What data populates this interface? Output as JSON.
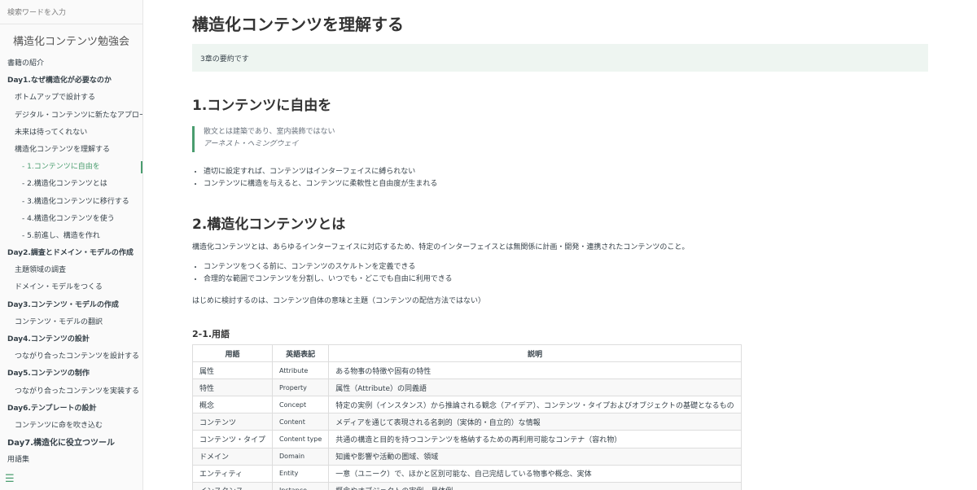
{
  "search": {
    "placeholder": "検索ワードを入力"
  },
  "sidebar": {
    "title": "構造化コンテンツ勉強会",
    "items": [
      {
        "label": "書籍の紹介"
      },
      {
        "label": "Day1.なぜ構造化が必要なのか"
      },
      {
        "label": "ボトムアップで設計する"
      },
      {
        "label": "デジタル・コンテンツに新たなアプロー..."
      },
      {
        "label": "未来は待ってくれない"
      },
      {
        "label": "構造化コンテンツを理解する"
      },
      {
        "label": "- 1.コンテンツに自由を"
      },
      {
        "label": "- 2.構造化コンテンツとは"
      },
      {
        "label": "- 3.構造化コンテンツに移行する"
      },
      {
        "label": "- 4.構造化コンテンツを使う"
      },
      {
        "label": "- 5.前進し、構造を作れ"
      },
      {
        "label": "Day2.調査とドメイン・モデルの作成"
      },
      {
        "label": "主題領域の調査"
      },
      {
        "label": "ドメイン・モデルをつくる"
      },
      {
        "label": "Day3.コンテンツ・モデルの作成"
      },
      {
        "label": "コンテンツ・モデルの翻訳"
      },
      {
        "label": "Day4.コンテンツの設計"
      },
      {
        "label": "つながり合ったコンテンツを設計する"
      },
      {
        "label": "Day5.コンテンツの制作"
      },
      {
        "label": "つながり合ったコンテンツを実装する"
      },
      {
        "label": "Day6.テンプレートの設計"
      },
      {
        "label": "コンテンツに命を吹き込む"
      },
      {
        "label": "Day7.構造化に役立つツール"
      },
      {
        "label": "用語集"
      }
    ],
    "menu_icon": "hamburger-icon",
    "accent_color": "#4a9d6f"
  },
  "main": {
    "title": "構造化コンテンツを理解する",
    "summary": "3章の要約です",
    "section1": {
      "heading": "1.コンテンツに自由を",
      "quote": "散文とは建築であり、室内装飾ではない",
      "quote_author": "アーネスト・ヘミングウェイ",
      "bullets": [
        "適切に設定すれば、コンテンツはインターフェイスに縛られない",
        "コンテンツに構造を与えると、コンテンツに柔軟性と自由度が生まれる"
      ]
    },
    "section2": {
      "heading": "2.構造化コンテンツとは",
      "intro": "構造化コンテンツとは、あらゆるインターフェイスに対応するため、特定のインターフェイスとは無関係に計画・開発・連携されたコンテンツのこと。",
      "bullets": [
        "コンテンツをつくる前に、コンテンツのスケルトンを定義できる",
        "合理的な範囲でコンテンツを分割し、いつでも・どこでも自由に利用できる"
      ],
      "note": "はじめに検討するのは、コンテンツ自体の意味と主題（コンテンツの配信方法ではない）",
      "sub_heading": "2-1.用語",
      "table": {
        "headers": [
          "用語",
          "英語表記",
          "説明"
        ],
        "rows": [
          [
            "属性",
            "Attribute",
            "ある物事の特徴や固有の特性"
          ],
          [
            "特性",
            "Property",
            "属性（Attribute）の同義語"
          ],
          [
            "概念",
            "Concept",
            "特定の実例（インスタンス）から推論される観念（アイデア）、コンテンツ・タイプおよびオブジェクトの基礎となるもの"
          ],
          [
            "コンテンツ",
            "Content",
            "メディアを通じて表現される名刺的（実体的・自立的）な情報"
          ],
          [
            "コンテンツ・タイプ",
            "Content type",
            "共通の構造と目的を持つコンテンツを格納するための再利用可能なコンテナ（容れ物）"
          ],
          [
            "ドメイン",
            "Domain",
            "知識や影響や活動の圏域、領域"
          ],
          [
            "エンティティ",
            "Entity",
            "一意（ユニーク）で、ほかと区別可能な、自己完結している物事や概念、実体"
          ],
          [
            "インスタンス",
            "Instance",
            "概念やオブジェクトの実例、具体例"
          ]
        ]
      }
    }
  }
}
